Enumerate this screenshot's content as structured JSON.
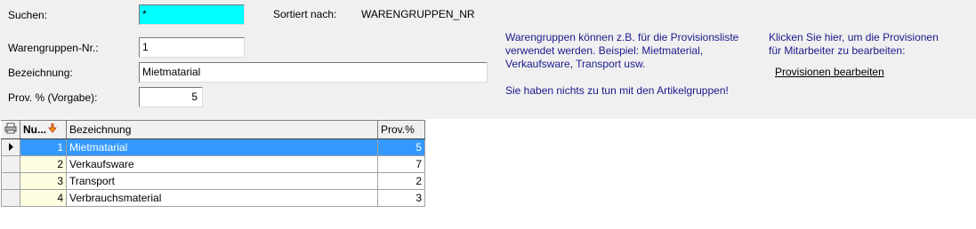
{
  "form": {
    "suchen_label": "Suchen:",
    "suchen_value": "*",
    "sortiert_label": "Sortiert nach:",
    "sortiert_value": "WARENGRUPPEN_NR",
    "nr_label": "Warengruppen-Nr.:",
    "nr_value": "1",
    "bezeichnung_label": "Bezeichnung:",
    "bezeichnung_value": "Mietmatarial",
    "prov_label": "Prov. % (Vorgabe):",
    "prov_value": "5"
  },
  "info": {
    "line1": "Warengruppen können z.B. für die Provisionsliste",
    "line2": "verwendet werden. Beispiel: Mietmaterial,",
    "line3": "Verkaufsware, Transport usw.",
    "line4": "Sie haben nichts zu tun mit den Artikelgruppen!"
  },
  "provision": {
    "line1": "Klicken Sie hier, um die Provisionen",
    "line2": "für Mitarbeiter zu bearbeiten:",
    "link": "Provisionen bearbeiten"
  },
  "grid": {
    "columns": [
      "Nu...",
      "Bezeichnung",
      "Prov.%"
    ],
    "rows": [
      {
        "nr": "1",
        "bez": "Mietmatarial",
        "prov": "5"
      },
      {
        "nr": "2",
        "bez": "Verkaufsware",
        "prov": "7"
      },
      {
        "nr": "3",
        "bez": "Transport",
        "prov": "2"
      },
      {
        "nr": "4",
        "bez": "Verbrauchsmaterial",
        "prov": "3"
      }
    ],
    "selected_row": 0
  },
  "colors": {
    "search_bg": "#00ffff",
    "selection": "#3399ff",
    "info_text": "#1a1a8c"
  }
}
